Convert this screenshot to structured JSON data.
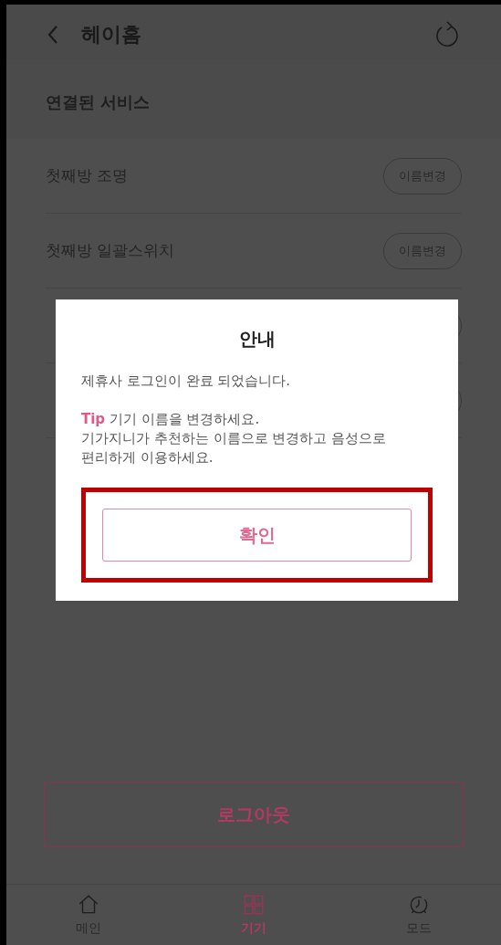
{
  "header": {
    "title": "헤이홈"
  },
  "section": {
    "title": "연결된 서비스"
  },
  "devices": [
    {
      "kind": "full",
      "name": "첫째방 조명",
      "button": "이름변경"
    },
    {
      "kind": "full",
      "name": "첫째방 일괄스위치",
      "button": "이름변경"
    },
    {
      "kind": "covered"
    },
    {
      "kind": "covered"
    }
  ],
  "dialog": {
    "title": "안내",
    "message": "제휴사 로그인이 완료 되었습니다.",
    "tip": {
      "label": "Tip",
      "text": "기기 이름을 변경하세요.\n기가지니가 추천하는 이름으로 변경하고 음성으로\n편리하게 이용하세요."
    },
    "confirm": {
      "label": "확인",
      "highlighted": true
    }
  },
  "logout_button": "로그아웃",
  "nav": [
    {
      "kind": "home",
      "label": "메인",
      "selected": false
    },
    {
      "kind": "grid",
      "label": "기기",
      "selected": true
    },
    {
      "kind": "clock",
      "label": "모드",
      "selected": false
    }
  ]
}
